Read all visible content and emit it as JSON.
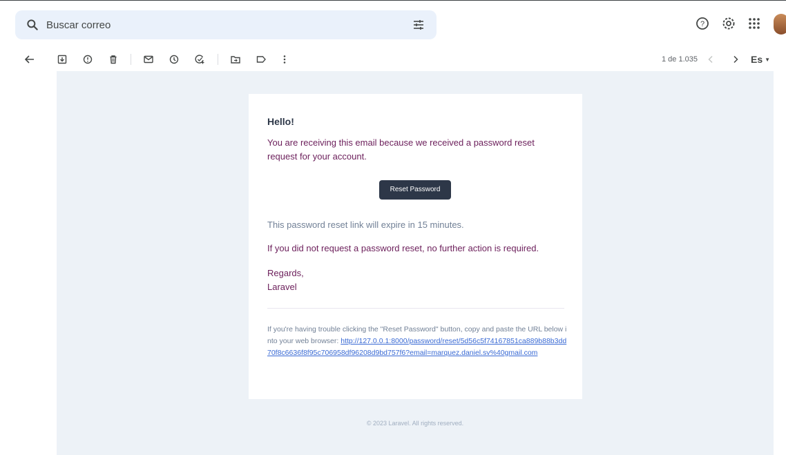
{
  "search": {
    "placeholder": "Buscar correo"
  },
  "header_icons": [
    "help-icon",
    "settings-icon",
    "apps-icon"
  ],
  "toolbar": {
    "pager": "1 de 1.035",
    "lang": "Es"
  },
  "email": {
    "greeting": "Hello!",
    "intro": "You are receiving this email because we received a password reset request for your account.",
    "button": "Reset Password",
    "expire": "This password reset link will expire in 15 minutes.",
    "no_action": "If you did not request a password reset, no further action is required.",
    "regards": "Regards,",
    "sender": "Laravel",
    "trouble": "If you're having trouble clicking the \"Reset Password\" button, copy and paste the URL below into your web browser:",
    "url": "http://127.0.0.1:8000/password/reset/5d56c5f74167851ca889b88b3dd70f8c6636f8f95c706958df96208d9bd757f6?email=marquez.daniel.sv%40gmail.com",
    "footer": "© 2023 Laravel. All rights reserved."
  },
  "colors": {
    "search_bg": "#eaf1fb",
    "canvas_bg": "#edf2f7",
    "button_bg": "#2d3748",
    "body_text": "#6b1e5a",
    "link": "#3869d4"
  }
}
